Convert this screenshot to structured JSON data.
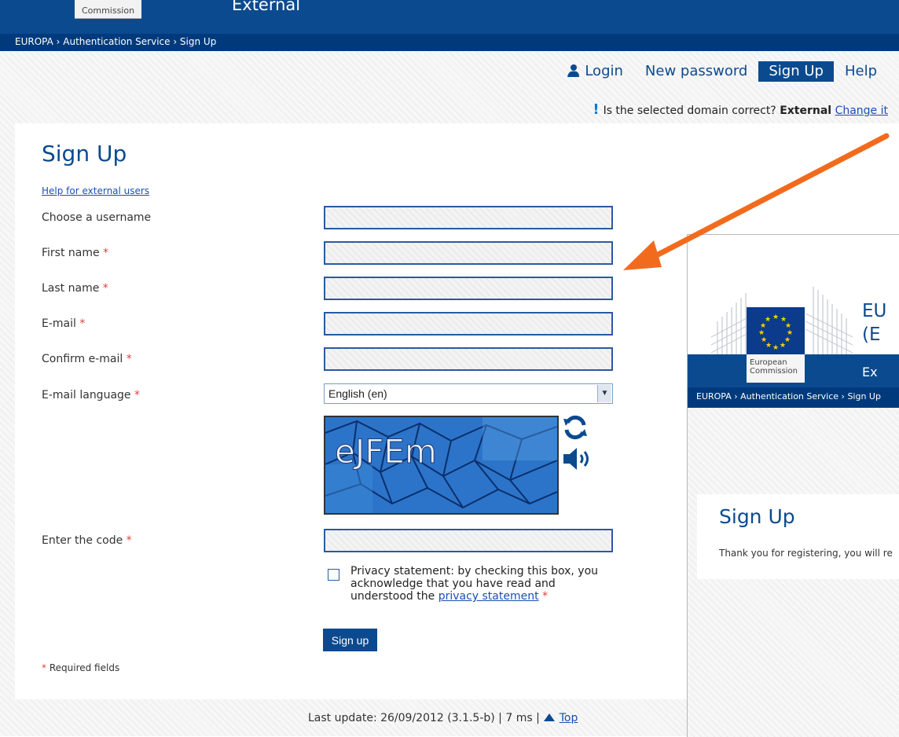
{
  "header": {
    "commission_tab": "Commission",
    "domain_title": "External"
  },
  "breadcrumb": "EUROPA › Authentication Service › Sign Up",
  "topnav": {
    "items": [
      {
        "label": "Login",
        "active": false
      },
      {
        "label": "New password",
        "active": false
      },
      {
        "label": "Sign Up",
        "active": true
      },
      {
        "label": "Help",
        "active": false
      }
    ]
  },
  "domain_check": {
    "question": "Is the selected domain correct?",
    "domain": "External",
    "change_link": "Change it"
  },
  "form": {
    "title": "Sign Up",
    "help_link": "Help for external users",
    "fields": {
      "username": {
        "label": "Choose a username",
        "required": false,
        "value": ""
      },
      "first_name": {
        "label": "First name",
        "required": true,
        "value": ""
      },
      "last_name": {
        "label": "Last name",
        "required": true,
        "value": ""
      },
      "email": {
        "label": "E-mail",
        "required": true,
        "value": ""
      },
      "confirm_email": {
        "label": "Confirm e-mail",
        "required": true,
        "value": ""
      },
      "email_language": {
        "label": "E-mail language",
        "required": true,
        "value": "English (en)"
      },
      "code": {
        "label": "Enter the code",
        "required": true,
        "value": ""
      }
    },
    "captcha_text": "eJFEm",
    "privacy": {
      "text_before": "Privacy statement: by checking this box, you acknowledge that you have read and understood the ",
      "link": "privacy statement",
      "checked": false
    },
    "submit_label": "Sign up",
    "required_note": "Required fields",
    "required_marker": "*"
  },
  "footer": {
    "text": "Last update: 26/09/2012 (3.1.5-b) | 7 ms |",
    "top_link": "Top"
  },
  "overlay": {
    "logo_text": "European Commission",
    "title_fragment": "EU\n(E",
    "domain_fragment": "Ex",
    "breadcrumb": "EUROPA › Authentication Service › Sign Up",
    "heading": "Sign Up",
    "message": "Thank you for registering, you will re"
  },
  "colors": {
    "brand_blue": "#0b4a8f",
    "arrow": "#f26b1d",
    "required": "#e04040"
  }
}
